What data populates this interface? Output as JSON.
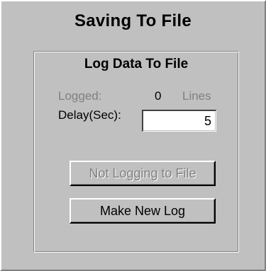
{
  "window": {
    "title": "Saving To File"
  },
  "group": {
    "title": "Log Data To File",
    "logged_label": "Logged:",
    "logged_value": "0",
    "logged_unit": "Lines",
    "delay_label": "Delay(Sec):",
    "delay_value": "5"
  },
  "buttons": {
    "logging_status_label": "Not Logging to File",
    "make_new_log_label": "Make New Log"
  }
}
